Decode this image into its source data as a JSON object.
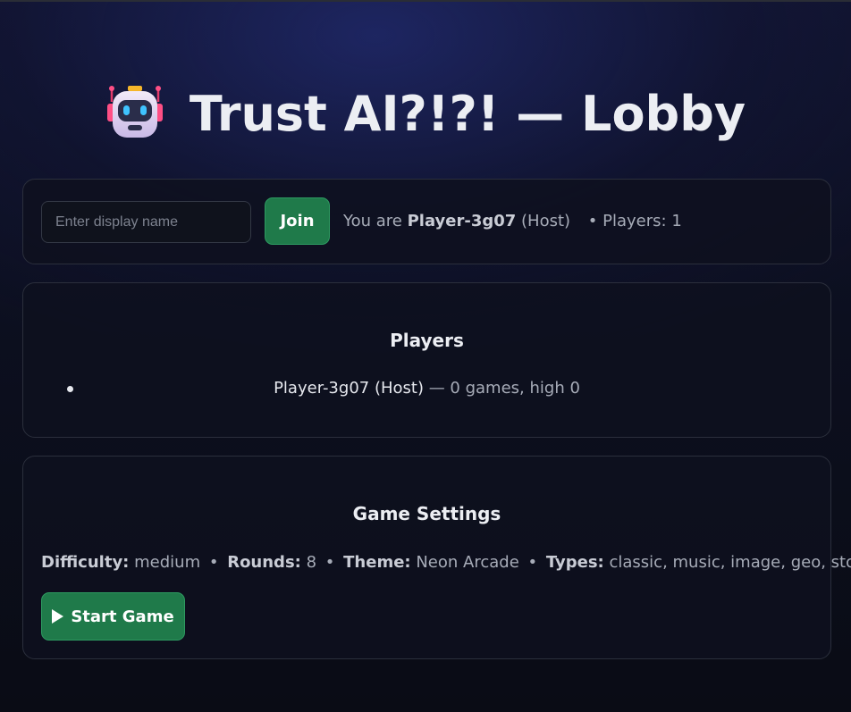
{
  "header": {
    "icon": "robot-icon",
    "title": "Trust AI?!?! — Lobby"
  },
  "join": {
    "placeholder": "Enter display name",
    "value": "",
    "button_label": "Join",
    "status_prefix": "You are",
    "player_name": "Player-3g07",
    "player_role": "(Host)",
    "players_count_text": "• Players: 1"
  },
  "players": {
    "title": "Players",
    "items": [
      {
        "name": "Player-3g07 (Host)",
        "stats": "— 0 games, high 0"
      }
    ]
  },
  "settings": {
    "title": "Game Settings",
    "difficulty_label": "Difficulty:",
    "difficulty_value": "medium",
    "rounds_label": "Rounds:",
    "rounds_value": "8",
    "theme_label": "Theme:",
    "theme_value": "Neon Arcade",
    "types_label": "Types:",
    "types_value": "classic, music, image, geo, stocks",
    "separator": "•",
    "start_label": "Start Game",
    "start_icon": "play-icon"
  },
  "colors": {
    "accent_green": "#1f7a4a",
    "background": "#0c0f1f",
    "card": "#0e111e"
  }
}
